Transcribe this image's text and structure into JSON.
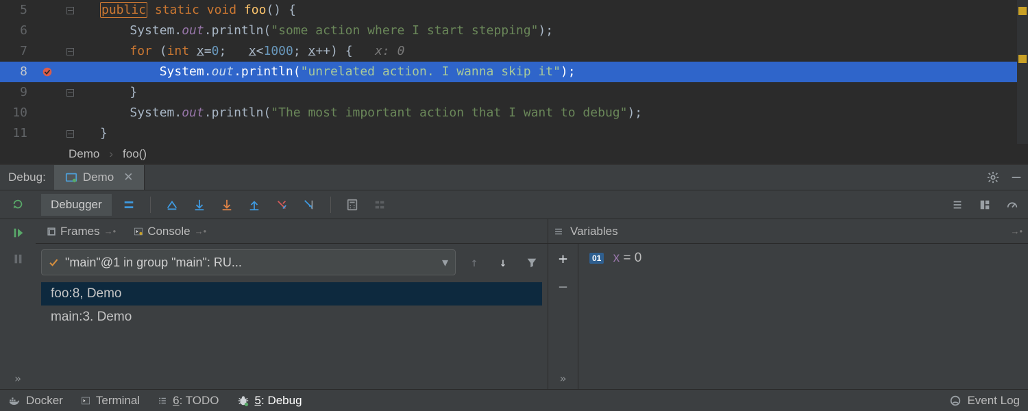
{
  "editor": {
    "lines": [
      {
        "num": 5,
        "fold": true
      },
      {
        "num": 6
      },
      {
        "num": 7,
        "fold": true,
        "hint": "x: 0"
      },
      {
        "num": 8,
        "breakpoint": true,
        "current": true
      },
      {
        "num": 9,
        "fold": true
      },
      {
        "num": 10
      },
      {
        "num": 11,
        "fold": true
      }
    ],
    "code": {
      "l5_public": "public",
      "l5_rest": " static void ",
      "l5_foo": "foo",
      "l5_tail": "() {",
      "l6_a": "System.",
      "l6_out": "out",
      "l6_b": ".println(",
      "l6_str": "\"some action where I start stepping\"",
      "l6_c": ");",
      "l7_for": "for ",
      "l7_int": "int ",
      "l7_x1": "x",
      "l7_eq": "=",
      "l7_zero": "0",
      "l7_semi1": ";   ",
      "l7_x2": "x",
      "l7_lt": "<",
      "l7_thou": "1000",
      "l7_semi2": "; ",
      "l7_x3": "x",
      "l7_pp": "++) {",
      "l8_a": "System.",
      "l8_out": "out",
      "l8_b": ".println(",
      "l8_str": "\"unrelated action. I wanna skip it\"",
      "l8_c": ");",
      "l9": "}",
      "l10_a": "System.",
      "l10_out": "out",
      "l10_b": ".println(",
      "l10_str": "\"The most important action that I want to debug\"",
      "l10_c": ");",
      "l11": "}"
    }
  },
  "breadcrumb": {
    "a": "Demo",
    "b": "foo()"
  },
  "debugHeader": {
    "label": "Debug:",
    "tab": "Demo"
  },
  "debugToolbar": {
    "tab": "Debugger"
  },
  "framesPane": {
    "title": "Frames",
    "consoleTab": "Console",
    "thread": "\"main\"@1 in group \"main\": RU...",
    "stack": [
      "foo:8, Demo",
      "main:3. Demo"
    ]
  },
  "varsPane": {
    "title": "Variables",
    "chip": "01",
    "name": "x",
    "value": "= 0"
  },
  "statusbar": {
    "docker": "Docker",
    "terminal": "Terminal",
    "todoNum": "6",
    "todoLabel": ": TODO",
    "debugNum": "5",
    "debugLabel": ": Debug",
    "eventLog": "Event Log"
  }
}
